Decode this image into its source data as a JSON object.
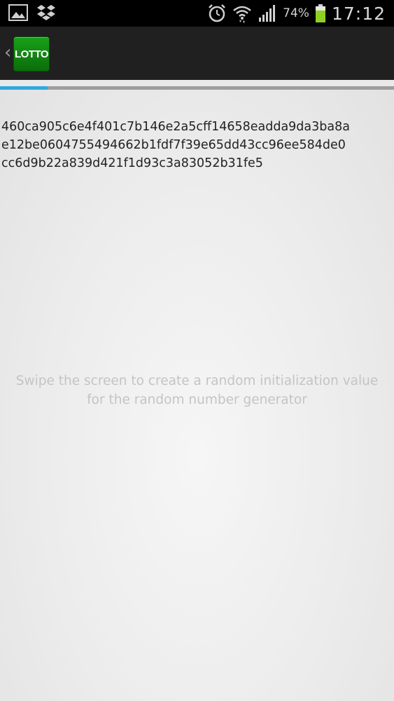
{
  "status_bar": {
    "icons_left": [
      "gallery-icon",
      "dropbox-icon"
    ],
    "icons_right": [
      "alarm-icon",
      "wifi-icon",
      "signal-icon"
    ],
    "battery_percent": "74%",
    "battery_level": 0.74,
    "time": "17:12"
  },
  "action_bar": {
    "app_icon_label": "LOTTO",
    "accent_color": "#1a8f1a"
  },
  "progress": {
    "value": 0.12,
    "color": "#33a8e0"
  },
  "main": {
    "hash_lines": [
      "460ca905c6e4f401c7b146e2a5cff14658eadda9da3ba8a",
      "e12be0604755494662b1fdf7f39e65dd43cc96ee584de0",
      "cc6d9b22a839d421f1d93c3a83052b31fe5"
    ],
    "hint_lines": [
      "Swipe the screen to create a random initialization value",
      "for the random number generator"
    ]
  }
}
